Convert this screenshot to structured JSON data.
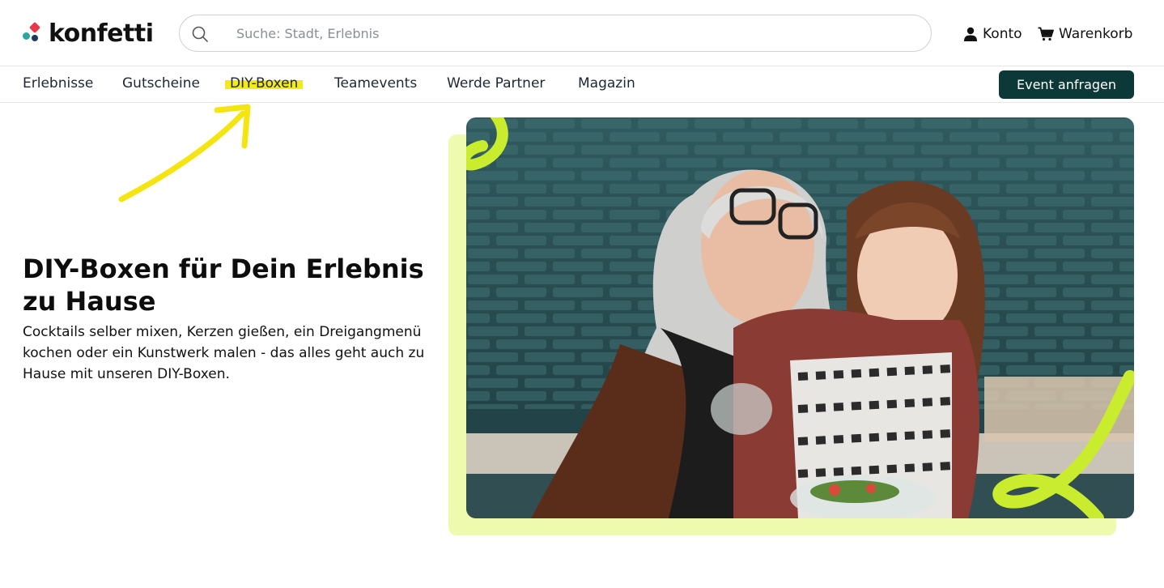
{
  "brand": {
    "name": "konfetti"
  },
  "search": {
    "placeholder": "Suche: Stadt, Erlebnis",
    "icon": "search-icon"
  },
  "header": {
    "konto_label": "Konto",
    "warenkorb_label": "Warenkorb"
  },
  "nav": {
    "items": [
      {
        "label": "Erlebnisse"
      },
      {
        "label": "Gutscheine"
      },
      {
        "label": "DIY-Boxen",
        "highlighted": true
      },
      {
        "label": "Teamevents"
      },
      {
        "label": "Werde Partner"
      },
      {
        "label": "Magazin"
      }
    ],
    "cta_label": "Event anfragen"
  },
  "hero": {
    "title": "DIY-Boxen für Dein Erlebnis zu Hause",
    "text": "Cocktails selber mixen, Kerzen gießen, ein Dreigangmenü kochen oder ein Kunstwerk malen - das alles geht auch zu Hause mit unseren DIY-Boxen."
  },
  "colors": {
    "highlight": "#f4ea19",
    "cta_bg": "#0d3838",
    "backdrop": "#eefbaf",
    "lime": "#c9ec2e",
    "logo_red": "#e8374a",
    "logo_teal": "#2aa8a0"
  }
}
